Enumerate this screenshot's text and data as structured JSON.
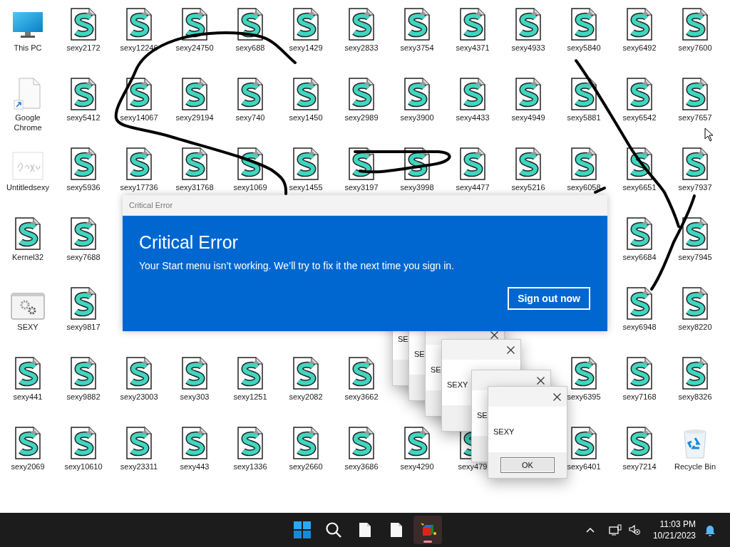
{
  "desktop": {
    "rows": [
      [
        {
          "label": "This PC",
          "kind": "pc"
        },
        {
          "label": "sexy2172",
          "kind": "script"
        },
        {
          "label": "sexy12246",
          "kind": "script"
        },
        {
          "label": "sexy24750",
          "kind": "script"
        },
        {
          "label": "sexy688",
          "kind": "script"
        },
        {
          "label": "sexy1429",
          "kind": "script"
        },
        {
          "label": "sexy2833",
          "kind": "script"
        },
        {
          "label": "sexy3754",
          "kind": "script"
        },
        {
          "label": "sexy4371",
          "kind": "script"
        },
        {
          "label": "sexy4933",
          "kind": "script"
        },
        {
          "label": "sexy5840",
          "kind": "script"
        },
        {
          "label": "sexy6492",
          "kind": "script"
        },
        {
          "label": "sexy7600",
          "kind": "script"
        }
      ],
      [
        {
          "label": "Google Chrome",
          "kind": "shortcut"
        },
        {
          "label": "sexy5412",
          "kind": "script"
        },
        {
          "label": "sexy14067",
          "kind": "script"
        },
        {
          "label": "sexy29194",
          "kind": "script"
        },
        {
          "label": "sexy740",
          "kind": "script"
        },
        {
          "label": "sexy1450",
          "kind": "script"
        },
        {
          "label": "sexy2989",
          "kind": "script"
        },
        {
          "label": "sexy3900",
          "kind": "script"
        },
        {
          "label": "sexy4433",
          "kind": "script"
        },
        {
          "label": "sexy4949",
          "kind": "script"
        },
        {
          "label": "sexy5881",
          "kind": "script"
        },
        {
          "label": "sexy6542",
          "kind": "script"
        },
        {
          "label": "sexy7657",
          "kind": "script"
        }
      ],
      [
        {
          "label": "Untitledsexy",
          "kind": "image"
        },
        {
          "label": "sexy5936",
          "kind": "script"
        },
        {
          "label": "sexy17736",
          "kind": "script"
        },
        {
          "label": "sexy31768",
          "kind": "script"
        },
        {
          "label": "sexy1069",
          "kind": "script"
        },
        {
          "label": "sexy1455",
          "kind": "script"
        },
        {
          "label": "sexy3197",
          "kind": "script"
        },
        {
          "label": "sexy3998",
          "kind": "script"
        },
        {
          "label": "sexy4477",
          "kind": "script"
        },
        {
          "label": "sexy5216",
          "kind": "script"
        },
        {
          "label": "sexy6058",
          "kind": "script"
        },
        {
          "label": "sexy6651",
          "kind": "script"
        },
        {
          "label": "sexy7937",
          "kind": "script"
        }
      ],
      [
        {
          "label": "Kernel32",
          "kind": "script"
        },
        {
          "label": "sexy7688",
          "kind": "script"
        },
        null,
        null,
        null,
        null,
        null,
        null,
        null,
        null,
        null,
        {
          "label": "sexy6684",
          "kind": "script"
        },
        {
          "label": "sexy7945",
          "kind": "script"
        }
      ],
      [
        {
          "label": "SEXY",
          "kind": "settings"
        },
        {
          "label": "sexy9817",
          "kind": "script"
        },
        null,
        null,
        null,
        null,
        null,
        null,
        null,
        null,
        null,
        {
          "label": "sexy6948",
          "kind": "script"
        },
        {
          "label": "sexy8220",
          "kind": "script"
        }
      ],
      [
        {
          "label": "sexy441",
          "kind": "script"
        },
        {
          "label": "sexy9882",
          "kind": "script"
        },
        {
          "label": "sexy23003",
          "kind": "script"
        },
        {
          "label": "sexy303",
          "kind": "script"
        },
        {
          "label": "sexy1251",
          "kind": "script"
        },
        {
          "label": "sexy2082",
          "kind": "script"
        },
        {
          "label": "sexy3662",
          "kind": "script"
        },
        null,
        null,
        null,
        {
          "label": "sexy6395",
          "kind": "script"
        },
        {
          "label": "sexy7168",
          "kind": "script"
        },
        {
          "label": "sexy8326",
          "kind": "script"
        }
      ],
      [
        {
          "label": "sexy2069",
          "kind": "script"
        },
        {
          "label": "sexy10610",
          "kind": "script"
        },
        {
          "label": "sexy23311",
          "kind": "script"
        },
        {
          "label": "sexy443",
          "kind": "script"
        },
        {
          "label": "sexy1336",
          "kind": "script"
        },
        {
          "label": "sexy2660",
          "kind": "script"
        },
        {
          "label": "sexy3686",
          "kind": "script"
        },
        {
          "label": "sexy4290",
          "kind": "script"
        },
        {
          "label": "sexy479",
          "kind": "script"
        },
        null,
        {
          "label": "sexy6401",
          "kind": "script"
        },
        {
          "label": "sexy7214",
          "kind": "script"
        },
        {
          "label": "Recycle Bin",
          "kind": "recycle"
        }
      ]
    ]
  },
  "error_dialog": {
    "title": "Critical Error",
    "heading": "Critical Error",
    "message": "Your Start menu isn’t working. We’ll try to fix it the next time you sign in.",
    "button": "Sign out now"
  },
  "message_boxes": [
    {
      "message": "SE"
    },
    {
      "message": "SE"
    },
    {
      "message": "SE"
    },
    {
      "message": "SEXY"
    },
    {
      "message": "SE"
    },
    {
      "message": "SEXY",
      "button": "OK"
    }
  ],
  "taskbar": {
    "items": [
      {
        "kind": "start",
        "selected": false
      },
      {
        "kind": "search",
        "selected": false
      },
      {
        "kind": "file",
        "selected": false
      },
      {
        "kind": "file",
        "selected": false
      },
      {
        "kind": "app",
        "selected": true
      }
    ],
    "time": "11:03 PM",
    "date": "10/21/2023"
  }
}
